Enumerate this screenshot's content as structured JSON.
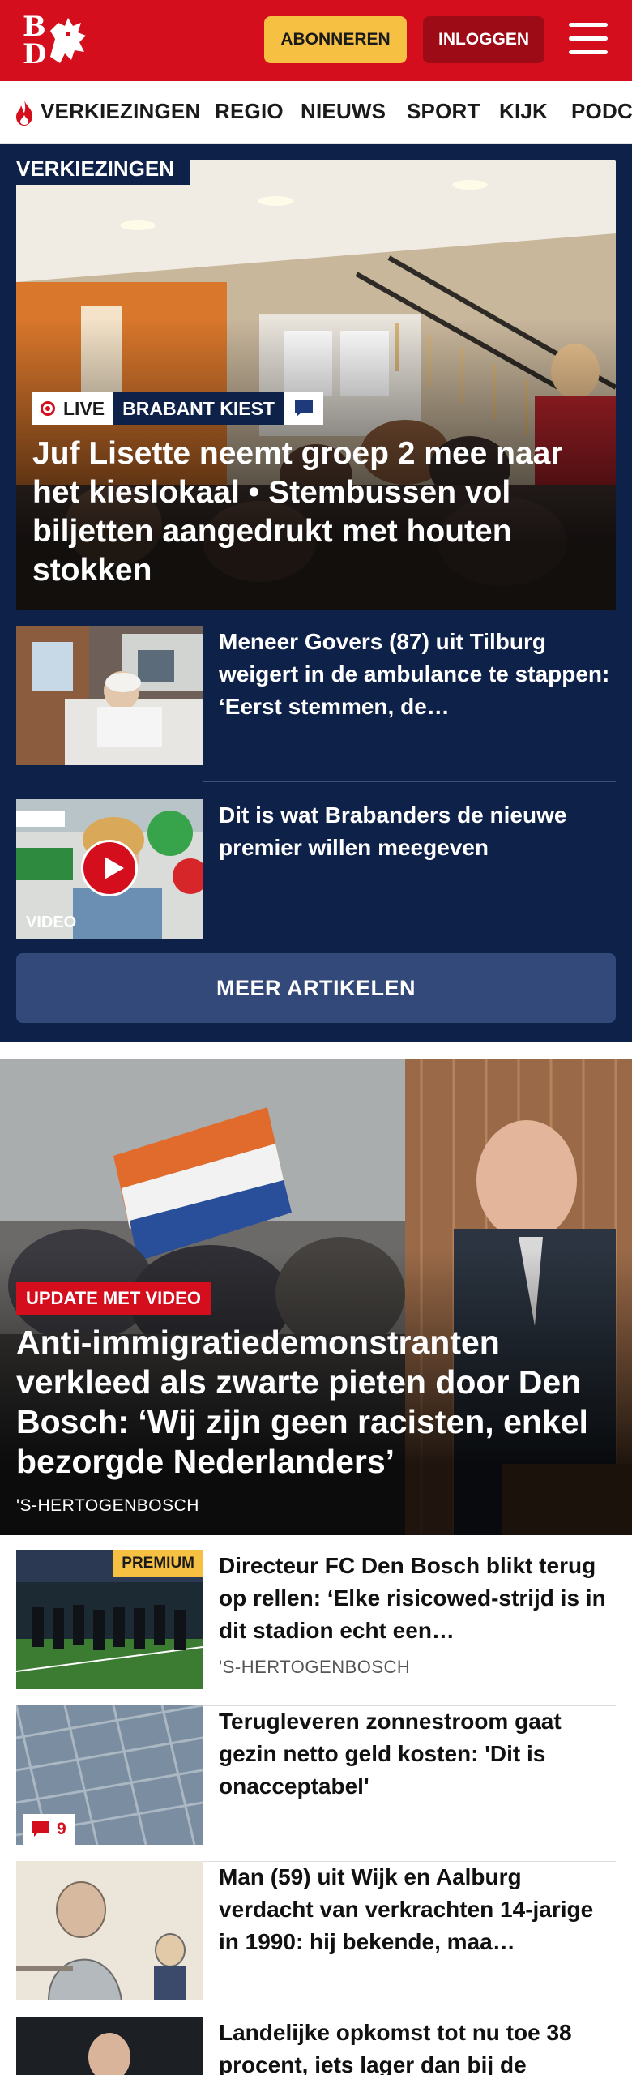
{
  "header": {
    "logo_top": "B",
    "logo_bottom": "D",
    "subscribe_label": "ABONNEREN",
    "login_label": "INLOGGEN"
  },
  "nav": {
    "items": [
      "VERKIEZINGEN",
      "REGIO",
      "NIEUWS",
      "SPORT",
      "KIJK",
      "PODC"
    ]
  },
  "elections": {
    "section_label": "VERKIEZINGEN",
    "hero": {
      "live_label": "LIVE",
      "tag": "BRABANT KIEST",
      "title": "Juf Lisette neemt groep 2 mee naar het kieslokaal • Stembussen vol biljetten aangedrukt met houten stokken"
    },
    "stories": [
      {
        "title": "Meneer Govers (87) uit Tilburg weigert in de ambulance te stappen: ‘Eerst stemmen, de…"
      },
      {
        "title": "Dit is wat Brabanders de nieuwe premier willen meegeven",
        "video_label": "VIDEO"
      }
    ],
    "more_label": "MEER ARTIKELEN"
  },
  "main_story": {
    "badge": "UPDATE MET VIDEO",
    "title": "Anti-immigratiedemonstranten verkleed als zwarte pieten door Den Bosch: ‘Wij zijn geen racisten, enkel bezorgde Nederlanders’",
    "location": "'S-HERTOGENBOSCH"
  },
  "list": [
    {
      "title": "Directeur FC Den Bosch blikt terug op rellen: ‘Elke risicowed-strijd is in dit stadion echt een…",
      "location": "'S-HERTOGENBOSCH",
      "badge": "PREMIUM"
    },
    {
      "title": "Terugleveren zonnestroom gaat gezin netto geld kosten: 'Dit is onacceptabel'",
      "comments": "9"
    },
    {
      "title": "Man (59) uit Wijk en Aalburg verdacht van verkrachten 14-jarige in 1990: hij bekende, maa…"
    },
    {
      "title": "Landelijke opkomst tot nu toe 38 procent, iets lager dan bij de"
    }
  ],
  "colors": {
    "brand_red": "#d40e1c",
    "navy": "#0e2149",
    "subscribe_yellow": "#f6c043"
  }
}
